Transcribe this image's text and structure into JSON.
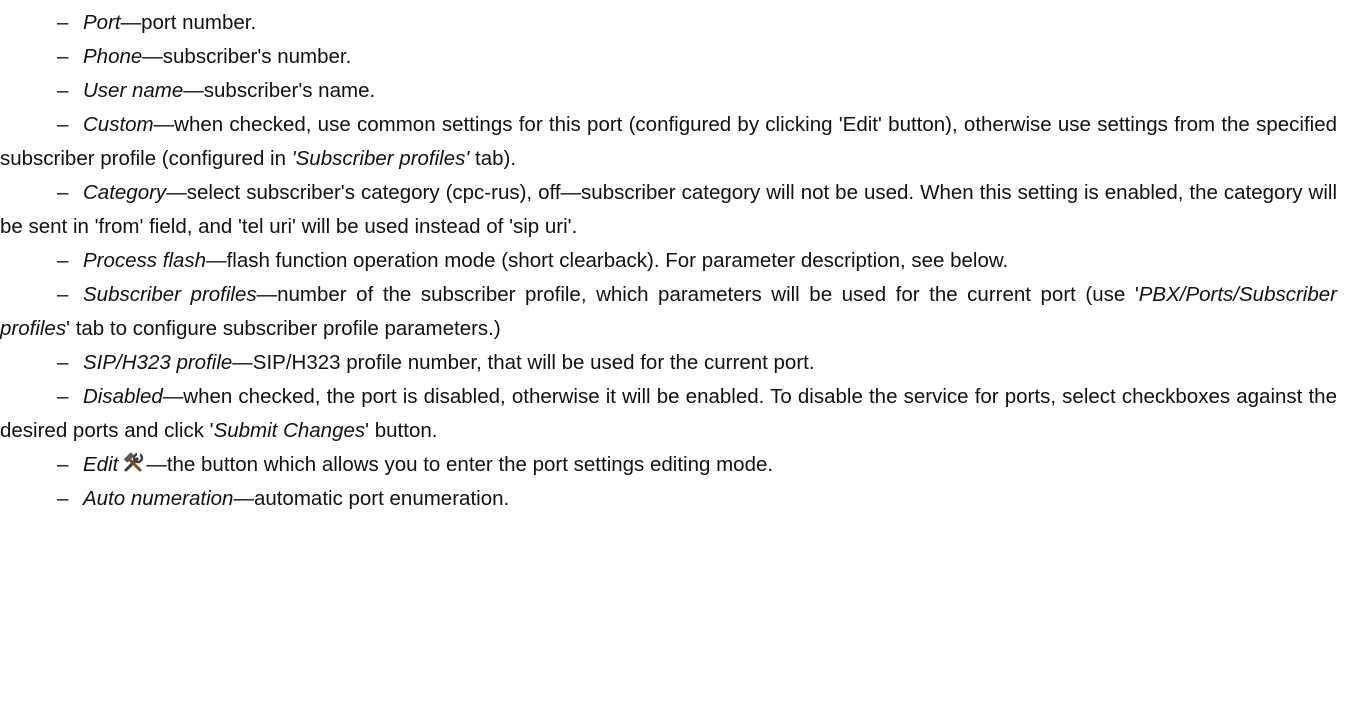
{
  "items": [
    {
      "dash": "–",
      "term": "Port",
      "text": "—port number."
    },
    {
      "dash": "–",
      "term": "Phone",
      "text": "—subscriber's number."
    },
    {
      "dash": "–",
      "term": "User name",
      "text": "—subscriber's name."
    },
    {
      "dash": "–",
      "term": "Custom",
      "text_a": "—when checked, use common settings for this port (configured by clicking 'Edit' button), otherwise use settings from the specified subscriber profile (configured in ",
      "em": "'Subscriber profiles'",
      "text_b": " tab)."
    },
    {
      "dash": "–",
      "term": "Category",
      "text": "—select subscriber's category (cpc-rus), off—subscriber category will not be used. When this setting is enabled, the category will be sent in 'from' field, and 'tel uri' will be used instead of 'sip uri'."
    },
    {
      "dash": "–",
      "term": "Process flash",
      "text": "—flash function operation mode (short clearback). For parameter description, see below."
    },
    {
      "dash": "–",
      "term": "Subscriber profiles",
      "text_a": "—number of the subscriber profile, which parameters will be used for the current port (use '",
      "em": "PBX/Ports/Subscriber profiles",
      "text_b": "' tab to configure subscriber profile parameters.)"
    },
    {
      "dash": "–",
      "term": "SIP/H323 profile",
      "text": "—SIP/H323 profile number, that will be used for the current port."
    },
    {
      "dash": "–",
      "term": "Disabled",
      "text_a": "—when checked, the port is disabled, otherwise it will be enabled. To disable the service for ports, select checkboxes against the desired ports and click '",
      "em": "Submit Changes",
      "text_b": "' button."
    },
    {
      "dash": "–",
      "term": "Edit",
      "icon": "tools-hammer-wrench-icon",
      "text": "—the button which allows you to enter the port settings editing mode."
    },
    {
      "dash": "–",
      "term": "Auto numeration",
      "text": "—automatic port enumeration."
    }
  ]
}
